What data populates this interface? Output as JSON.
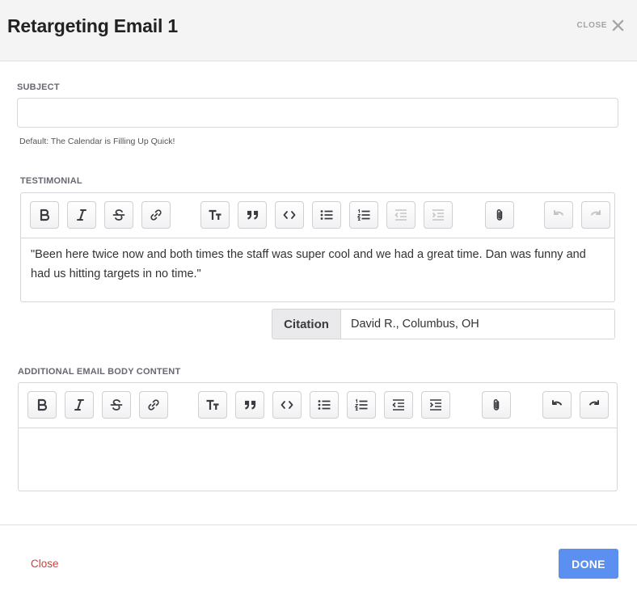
{
  "header": {
    "title": "Retargeting Email 1",
    "close_label": "CLOSE"
  },
  "subject": {
    "label": "SUBJECT",
    "value": "",
    "hint": "Default: The Calendar is Filling Up Quick!"
  },
  "testimonial": {
    "label": "TESTIMONIAL",
    "text": "\"Been here twice now and both times the staff was super cool and we had a great time. Dan was funny and had us hitting targets in no time.\"",
    "citation_label": "Citation",
    "citation_value": "David R., Columbus, OH"
  },
  "additional": {
    "label": "ADDITIONAL EMAIL BODY CONTENT",
    "text": ""
  },
  "toolbar_buttons": [
    "bold",
    "italic",
    "strikethrough",
    "link",
    "heading",
    "quote",
    "code",
    "bullet-list",
    "numbered-list",
    "decrease-indent",
    "increase-indent",
    "attach-file",
    "undo",
    "redo"
  ],
  "footer": {
    "close_label": "Close",
    "done_label": "DONE"
  },
  "colors": {
    "primary": "#5b8ff0",
    "danger": "#d23c3c",
    "header_bg": "#f4f4f5"
  }
}
